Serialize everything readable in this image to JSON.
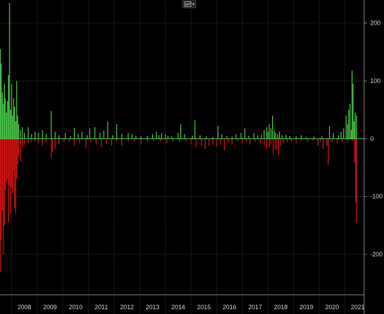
{
  "colors": {
    "background": "#000000",
    "grid": "#5a5a5a",
    "positive": "#4fd44f",
    "negative": "#e01515",
    "zero_line": "#4fd44f",
    "text": "#d8d8d8"
  },
  "toolbar": {
    "icon": "line-chart-icon",
    "dropdown_icon": "chevron-down-icon"
  },
  "chart_data": {
    "type": "bar",
    "title": "",
    "xlabel": "",
    "ylabel": "",
    "x_range": [
      2007.55,
      2021.75
    ],
    "ylim": [
      -270,
      240
    ],
    "y_ticks": [
      -200,
      -100,
      0,
      100,
      200
    ],
    "y_tick_labels": [
      "-200",
      "-100",
      "0",
      "100",
      "200"
    ],
    "x_tick_labels": [
      "2008",
      "2009",
      "2010",
      "2011",
      "2012",
      "2013",
      "2014",
      "2015",
      "2016",
      "2017",
      "2018",
      "2019",
      "2020",
      "2021"
    ],
    "grid": true,
    "legend": "none",
    "series": [
      {
        "sign": "positive",
        "points": [
          [
            2007.56,
            155
          ],
          [
            2007.6,
            130
          ],
          [
            2007.64,
            80
          ],
          [
            2007.68,
            60
          ],
          [
            2007.72,
            95
          ],
          [
            2007.76,
            70
          ],
          [
            2007.8,
            45
          ],
          [
            2007.84,
            65
          ],
          [
            2007.88,
            110
          ],
          [
            2007.92,
            235
          ],
          [
            2007.96,
            50
          ],
          [
            2008.0,
            95
          ],
          [
            2008.04,
            40
          ],
          [
            2008.08,
            70
          ],
          [
            2008.12,
            55
          ],
          [
            2008.16,
            30
          ],
          [
            2008.2,
            100
          ],
          [
            2008.24,
            40
          ],
          [
            2008.28,
            25
          ],
          [
            2008.35,
            15
          ],
          [
            2008.42,
            20
          ],
          [
            2008.5,
            10
          ],
          [
            2008.65,
            20
          ],
          [
            2008.78,
            8
          ],
          [
            2008.92,
            12
          ],
          [
            2009.05,
            10
          ],
          [
            2009.2,
            15
          ],
          [
            2009.35,
            8
          ],
          [
            2009.55,
            48
          ],
          [
            2009.7,
            12
          ],
          [
            2009.85,
            6
          ],
          [
            2010.1,
            10
          ],
          [
            2010.3,
            5
          ],
          [
            2010.45,
            18
          ],
          [
            2010.6,
            8
          ],
          [
            2010.75,
            12
          ],
          [
            2010.95,
            6
          ],
          [
            2011.05,
            18
          ],
          [
            2011.25,
            20
          ],
          [
            2011.45,
            10
          ],
          [
            2011.6,
            14
          ],
          [
            2011.75,
            30
          ],
          [
            2011.95,
            6
          ],
          [
            2012.1,
            25
          ],
          [
            2012.3,
            8
          ],
          [
            2012.55,
            10
          ],
          [
            2012.7,
            8
          ],
          [
            2012.85,
            5
          ],
          [
            2013.05,
            4
          ],
          [
            2013.3,
            5
          ],
          [
            2013.5,
            8
          ],
          [
            2013.65,
            12
          ],
          [
            2013.75,
            6
          ],
          [
            2013.85,
            10
          ],
          [
            2014.0,
            8
          ],
          [
            2014.1,
            5
          ],
          [
            2014.25,
            4
          ],
          [
            2014.5,
            10
          ],
          [
            2014.6,
            25
          ],
          [
            2014.75,
            8
          ],
          [
            2015.05,
            5
          ],
          [
            2015.15,
            32
          ],
          [
            2015.35,
            6
          ],
          [
            2015.6,
            4
          ],
          [
            2015.85,
            3
          ],
          [
            2016.05,
            22
          ],
          [
            2016.2,
            8
          ],
          [
            2016.4,
            5
          ],
          [
            2016.6,
            4
          ],
          [
            2016.75,
            8
          ],
          [
            2016.95,
            10
          ],
          [
            2017.1,
            18
          ],
          [
            2017.25,
            5
          ],
          [
            2017.45,
            10
          ],
          [
            2017.6,
            6
          ],
          [
            2017.75,
            7
          ],
          [
            2017.85,
            15
          ],
          [
            2017.95,
            20
          ],
          [
            2018.0,
            12
          ],
          [
            2018.05,
            25
          ],
          [
            2018.12,
            18
          ],
          [
            2018.18,
            40
          ],
          [
            2018.25,
            15
          ],
          [
            2018.3,
            10
          ],
          [
            2018.38,
            8
          ],
          [
            2018.45,
            12
          ],
          [
            2018.55,
            6
          ],
          [
            2018.7,
            7
          ],
          [
            2018.85,
            5
          ],
          [
            2019.1,
            4
          ],
          [
            2019.3,
            6
          ],
          [
            2019.5,
            3
          ],
          [
            2019.8,
            4
          ],
          [
            2020.1,
            5
          ],
          [
            2020.4,
            22
          ],
          [
            2020.55,
            10
          ],
          [
            2020.75,
            6
          ],
          [
            2020.85,
            12
          ],
          [
            2020.95,
            18
          ],
          [
            2021.05,
            40
          ],
          [
            2021.1,
            25
          ],
          [
            2021.15,
            50
          ],
          [
            2021.2,
            60
          ],
          [
            2021.25,
            15
          ],
          [
            2021.28,
            118
          ],
          [
            2021.32,
            95
          ],
          [
            2021.36,
            30
          ],
          [
            2021.4,
            45
          ],
          [
            2021.45,
            40
          ]
        ]
      },
      {
        "sign": "negative",
        "points": [
          [
            2007.56,
            -230
          ],
          [
            2007.6,
            -175
          ],
          [
            2007.64,
            -125
          ],
          [
            2007.68,
            -200
          ],
          [
            2007.72,
            -150
          ],
          [
            2007.76,
            -90
          ],
          [
            2007.8,
            -75
          ],
          [
            2007.84,
            -70
          ],
          [
            2007.88,
            -145
          ],
          [
            2007.92,
            -80
          ],
          [
            2007.96,
            -130
          ],
          [
            2008.0,
            -85
          ],
          [
            2008.04,
            -95
          ],
          [
            2008.08,
            -55
          ],
          [
            2008.12,
            -120
          ],
          [
            2008.16,
            -130
          ],
          [
            2008.2,
            -70
          ],
          [
            2008.24,
            -45
          ],
          [
            2008.28,
            -30
          ],
          [
            2008.35,
            -40
          ],
          [
            2008.42,
            -15
          ],
          [
            2008.5,
            -10
          ],
          [
            2008.65,
            -8
          ],
          [
            2008.78,
            -6
          ],
          [
            2008.92,
            -5
          ],
          [
            2009.05,
            -8
          ],
          [
            2009.2,
            -12
          ],
          [
            2009.35,
            -6
          ],
          [
            2009.55,
            -33
          ],
          [
            2009.6,
            -22
          ],
          [
            2009.7,
            -18
          ],
          [
            2009.85,
            -10
          ],
          [
            2010.05,
            -6
          ],
          [
            2010.25,
            -5
          ],
          [
            2010.45,
            -12
          ],
          [
            2010.65,
            -8
          ],
          [
            2010.9,
            -15
          ],
          [
            2011.1,
            -6
          ],
          [
            2011.3,
            -10
          ],
          [
            2011.5,
            -15
          ],
          [
            2011.7,
            -8
          ],
          [
            2011.9,
            -12
          ],
          [
            2012.1,
            -5
          ],
          [
            2012.3,
            -12
          ],
          [
            2012.55,
            -6
          ],
          [
            2012.8,
            -5
          ],
          [
            2013.05,
            -10
          ],
          [
            2013.3,
            -6
          ],
          [
            2013.55,
            -4
          ],
          [
            2013.8,
            -5
          ],
          [
            2014.05,
            -8
          ],
          [
            2014.3,
            -5
          ],
          [
            2014.55,
            -6
          ],
          [
            2014.8,
            -5
          ],
          [
            2015.0,
            -10
          ],
          [
            2015.2,
            -15
          ],
          [
            2015.4,
            -12
          ],
          [
            2015.55,
            -18
          ],
          [
            2015.7,
            -12
          ],
          [
            2015.85,
            -10
          ],
          [
            2016.0,
            -14
          ],
          [
            2016.15,
            -10
          ],
          [
            2016.3,
            -20
          ],
          [
            2016.45,
            -8
          ],
          [
            2016.6,
            -10
          ],
          [
            2016.8,
            -5
          ],
          [
            2017.0,
            -8
          ],
          [
            2017.15,
            -6
          ],
          [
            2017.3,
            -10
          ],
          [
            2017.5,
            -5
          ],
          [
            2017.7,
            -8
          ],
          [
            2017.85,
            -12
          ],
          [
            2017.95,
            -18
          ],
          [
            2018.05,
            -15
          ],
          [
            2018.12,
            -10
          ],
          [
            2018.2,
            -25
          ],
          [
            2018.28,
            -18
          ],
          [
            2018.35,
            -20
          ],
          [
            2018.42,
            -28
          ],
          [
            2018.5,
            -12
          ],
          [
            2018.6,
            -8
          ],
          [
            2018.75,
            -6
          ],
          [
            2018.9,
            -5
          ],
          [
            2019.1,
            -8
          ],
          [
            2019.3,
            -4
          ],
          [
            2019.55,
            -6
          ],
          [
            2019.75,
            -3
          ],
          [
            2019.95,
            -12
          ],
          [
            2020.05,
            -4
          ],
          [
            2020.15,
            -18
          ],
          [
            2020.3,
            -12
          ],
          [
            2020.35,
            -45
          ],
          [
            2020.5,
            -6
          ],
          [
            2020.7,
            -8
          ],
          [
            2020.9,
            -5
          ],
          [
            2021.1,
            -5
          ],
          [
            2021.3,
            -4
          ],
          [
            2021.38,
            -42
          ],
          [
            2021.42,
            -110
          ],
          [
            2021.46,
            -145
          ]
        ]
      }
    ]
  }
}
